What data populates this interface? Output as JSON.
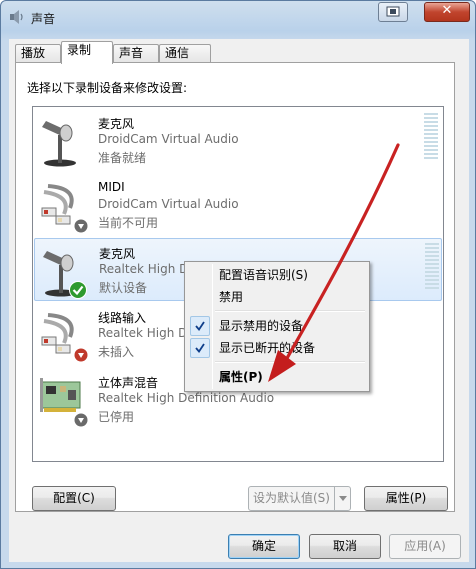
{
  "window": {
    "title": "声音"
  },
  "tabs": [
    {
      "label": "播放"
    },
    {
      "label": "录制"
    },
    {
      "label": "声音"
    },
    {
      "label": "通信"
    }
  ],
  "instruction": "选择以下录制设备来修改设置:",
  "devices": [
    {
      "name": "麦克风",
      "description": "DroidCam Virtual Audio",
      "status": "准备就绪",
      "icon": "microphone-icon"
    },
    {
      "name": "MIDI",
      "description": "DroidCam Virtual Audio",
      "status": "当前不可用",
      "icon": "cable-jack-icon",
      "badge": "down-arrow-badge"
    },
    {
      "name": "麦克风",
      "description": "Realtek High D",
      "status": "默认设备",
      "icon": "microphone-icon",
      "badge": "default-check-badge",
      "selected": true
    },
    {
      "name": "线路输入",
      "description": "Realtek High D",
      "status": "未插入",
      "icon": "cable-jack-icon",
      "badge": "unplugged-arrow-badge"
    },
    {
      "name": "立体声混音",
      "description": "Realtek High Definition Audio",
      "status": "已停用",
      "icon": "sound-card-icon",
      "badge": "down-arrow-badge"
    }
  ],
  "context_menu": {
    "items": [
      {
        "label": "配置语音识别(S)",
        "checked": false
      },
      {
        "label": "禁用",
        "checked": false
      },
      {
        "label": "显示禁用的设备",
        "checked": true
      },
      {
        "label": "显示已断开的设备",
        "checked": true
      },
      {
        "label": "属性(P)",
        "checked": false,
        "bold": true
      }
    ]
  },
  "buttons": {
    "configure": "配置(C)",
    "set_default": "设为默认值(S)",
    "properties": "属性(P)",
    "ok": "确定",
    "cancel": "取消",
    "apply": "应用(A)"
  },
  "colors": {
    "accent": "#3c7fb1",
    "annotation_arrow": "#d42020",
    "level_meter": "#c8dce6"
  }
}
